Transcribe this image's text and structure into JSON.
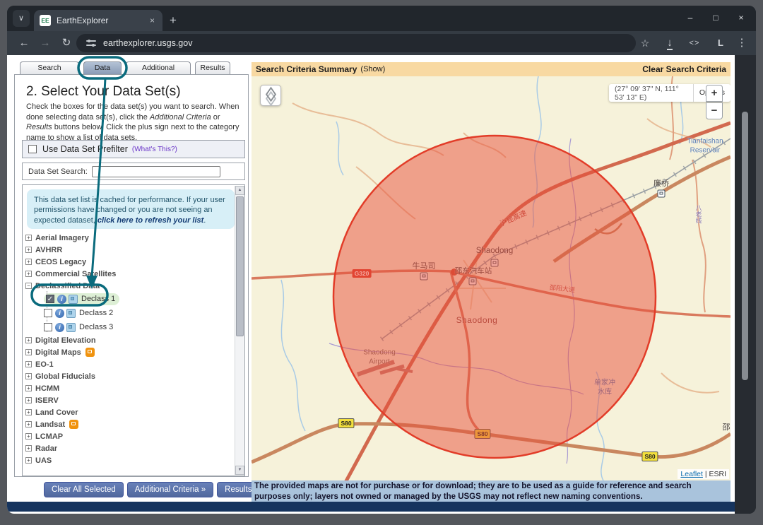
{
  "browser": {
    "tab_title": "EarthExplorer",
    "favicon_text": "EE",
    "url": "earthexplorer.usgs.gov",
    "profile_label": "L"
  },
  "icons": {
    "chevron_down": "∨",
    "close": "×",
    "new_tab": "+",
    "minimize": "–",
    "maximize": "□",
    "back": "←",
    "forward": "→",
    "reload": "↻",
    "star": "☆",
    "download_arrow": "↓",
    "code": "< >",
    "kebab": "⋮",
    "plus": "+",
    "minus": "−",
    "check": "✓",
    "info": "i",
    "up_arrow": "▲",
    "down_arrow": "▼"
  },
  "panel": {
    "tabs": [
      "Search Criteria",
      "Data Sets",
      "Additional Criteria",
      "Results"
    ],
    "heading": "2. Select Your Data Set(s)",
    "intro": {
      "p1": "Check the boxes for the data set(s) you want to search. When done selecting data set(s), click the ",
      "i1": "Additional Criteria",
      "p2": " or ",
      "i2": "Results",
      "p3": " buttons below. Click the plus sign next to the category name to show a list of data sets."
    },
    "prefilter_label": "Use Data Set Prefilter",
    "prefilter_link": "(What's This?)",
    "search_label": "Data Set Search:",
    "notice": {
      "text": "This data set list is cached for performance. If your user permissions have changed or you are not seeing an expected dataset, ",
      "link": "click here to refresh your list",
      "suffix": "."
    },
    "tree": [
      {
        "label": "Aerial Imagery"
      },
      {
        "label": "AVHRR"
      },
      {
        "label": "CEOS Legacy"
      },
      {
        "label": "Commercial Satellites"
      },
      {
        "label": "Declassified Data"
      },
      {
        "label": "Declass 1",
        "checked": true
      },
      {
        "label": "Declass 2",
        "checked": false
      },
      {
        "label": "Declass 3",
        "checked": false
      },
      {
        "label": "Digital Elevation"
      },
      {
        "label": "Digital Maps",
        "flag": true
      },
      {
        "label": "EO-1"
      },
      {
        "label": "Global Fiducials"
      },
      {
        "label": "HCMM"
      },
      {
        "label": "ISERV"
      },
      {
        "label": "Land Cover"
      },
      {
        "label": "Landsat",
        "flag": true
      },
      {
        "label": "LCMAP"
      },
      {
        "label": "Radar"
      },
      {
        "label": "UAS"
      }
    ],
    "buttons": [
      "Clear All Selected",
      "Additional Criteria »",
      "Results »"
    ]
  },
  "map": {
    "summary_label": "Search Criteria Summary",
    "summary_toggle": "(Show)",
    "clear_label": "Clear Search Criteria",
    "coordinates": "(27° 09' 37\" N, 111° 53' 13\" E)",
    "options_label": "Options",
    "zoom_in": "+",
    "zoom_out": "−",
    "labels": {
      "station_shaodong": "Shaodong",
      "niumasi": "牛马司",
      "bus_station": "邵东汽车站",
      "expressway": "沪昆高速",
      "city_shaodong": "Shaodong",
      "avenue": "邵阳大道",
      "lianqiao": "廉桥",
      "road_vertical": "八老线",
      "reservoir_l1": "Tianfaishan",
      "reservoir_l2": "Reservoir",
      "airport_l1": "Shaodong",
      "airport_l2": "Airport",
      "reservoir2_l1": "单家冲",
      "reservoir2_l2": "水库",
      "partial_east": "邵",
      "shield_g320": "G320",
      "shield_s80": "S80"
    },
    "attribution": {
      "leaflet": "Leaflet",
      "separator": " | ",
      "esri": "ESRI"
    },
    "colors": {
      "circle_fill": "#e84e3a",
      "circle_stroke": "#e23c28",
      "annotation": "#0a6b7d"
    }
  },
  "disclaimer": "The provided maps are not for purchase or for download; they are to be used as a guide for reference and search purposes only; layers not owned or managed by the USGS may not reflect new naming conventions."
}
